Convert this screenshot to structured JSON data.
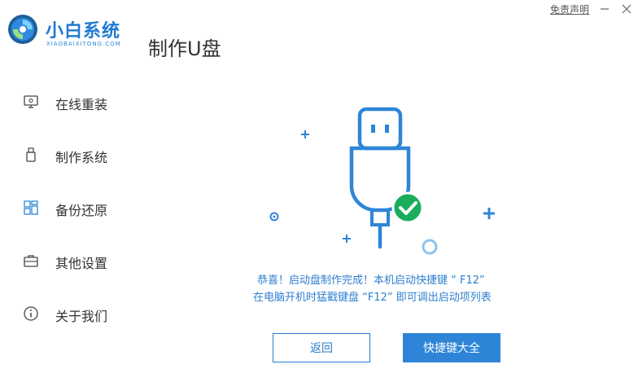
{
  "app": {
    "brand": "小白系统",
    "brand_sub": "XIAOBAIXITONG.COM",
    "page_title": "制作U盘",
    "disclaimer": "免责声明"
  },
  "sidebar": {
    "items": [
      {
        "label": "在线重装",
        "icon": "monitor-icon"
      },
      {
        "label": "制作系统",
        "icon": "usb-drive-icon"
      },
      {
        "label": "备份还原",
        "icon": "grid-icon"
      },
      {
        "label": "其他设置",
        "icon": "briefcase-icon"
      },
      {
        "label": "关于我们",
        "icon": "info-icon"
      }
    ]
  },
  "main": {
    "message_line1": "恭喜！启动盘制作完成！本机启动快捷键 “ F12”",
    "message_line2": "在电脑开机时猛戳键盘 “F12” 即可调出启动项列表",
    "back_label": "返回",
    "hotkeys_label": "快捷键大全"
  },
  "colors": {
    "accent": "#2e85d8",
    "success": "#1aad5b",
    "text": "#333333"
  }
}
